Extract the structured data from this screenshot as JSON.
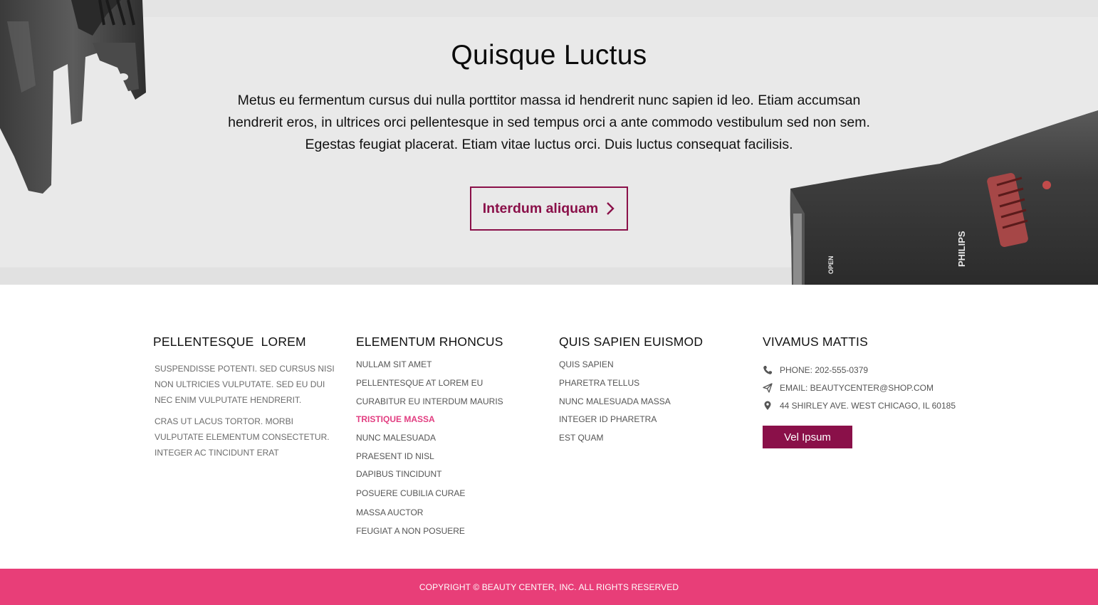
{
  "hero": {
    "title": "Quisque Luctus",
    "text": "Metus eu fermentum cursus dui nulla porttitor massa id hendrerit nunc sapien id leo. Etiam accumsan hendrerit eros, in ultrices orci pellentesque in sed tempus orci a ante commodo vestibulum sed non sem. Egestas feugiat placerat. Etiam vitae luctus orci. Duis luctus consequat facilisis.",
    "button_label": "Interdum aliquam",
    "product_brand": "PHILIPS",
    "product_open_label": "OPEN"
  },
  "footer": {
    "col1": {
      "heading": "PELLENTESQUE  LOREM",
      "para1": "Suspendisse potenti. Sed cursus nisi non ultricies vulputate. Sed eu dui nec enim vulputate hendrerit.",
      "para2": "Cras ut lacus tortor. Morbi vulputate elementum consectetur. Integer ac tincidunt erat"
    },
    "col2": {
      "heading": "ELEMENTUM RHONCUS",
      "links": [
        "NULLAM SIT AMET",
        "PELLENTESQUE AT LOREM EU",
        "CURABITUR EU INTERDUM MAURIS",
        "TRISTIQUE MASSA",
        "NUNC MALESUADA",
        "PRAESENT ID NISL",
        "DAPIBUS TINCIDUNT",
        "POSUERE CUBILIA CURAE",
        "MASSA AUCTOR",
        "FEUGIAT A NON POSUERE"
      ],
      "active_index": 3
    },
    "col3": {
      "heading": "QUIS SAPIEN EUISMOD",
      "links": [
        "QUIS SAPIEN",
        "PHARETRA TELLUS",
        "NUNC MALESUADA MASSA",
        "INTEGER ID PHARETRA",
        "EST QUAM"
      ]
    },
    "col4": {
      "heading": "VIVAMUS MATTIS",
      "contact": [
        {
          "icon": "phone-icon",
          "text": "PHONE: 202-555-0379"
        },
        {
          "icon": "paper-plane-icon",
          "text": "EMAIL: BEAUTYCENTER@SHOP.COM"
        },
        {
          "icon": "map-pin-icon",
          "text": "44 SHIRLEY AVE. WEST CHICAGO, IL 60185"
        }
      ],
      "button_label": "Vel Ipsum"
    }
  },
  "copyright": "COPYRIGHT © BEAUTY CENTER, INC. ALL RIGHTS RESERVED",
  "colors": {
    "accent": "#8a1049",
    "pink": "#e83e78",
    "active_link": "#e23d80"
  }
}
